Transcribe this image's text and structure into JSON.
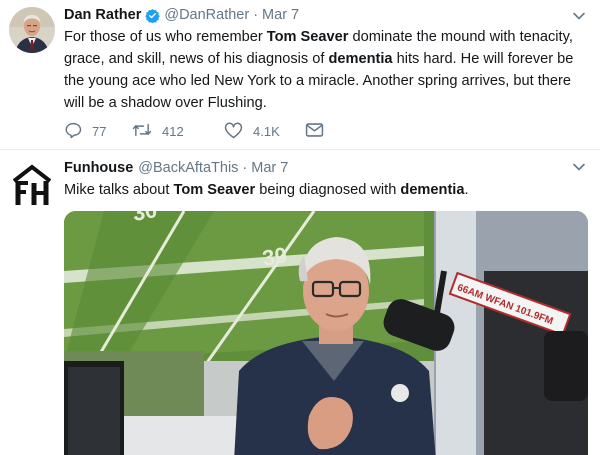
{
  "tweets": [
    {
      "author_name": "Dan Rather",
      "author_handle": "@DanRather",
      "separator": "·",
      "date": "Mar 7",
      "verified": true,
      "text_segments": [
        {
          "t": "For those of us who remember ",
          "b": false
        },
        {
          "t": "Tom Seaver",
          "b": true
        },
        {
          "t": " dominate the mound with tenacity, grace, and skill, news of his diagnosis of ",
          "b": false
        },
        {
          "t": "dementia",
          "b": true
        },
        {
          "t": " hits hard. He will forever be the young ace who led New York to a miracle. Another spring arrives, but there will be a shadow over Flushing.",
          "b": false
        }
      ],
      "actions": {
        "replies": "77",
        "retweets": "412",
        "likes": "4.1K"
      }
    },
    {
      "author_name": "Funhouse",
      "author_handle": "@BackAftaThis",
      "separator": "·",
      "date": "Mar 7",
      "verified": false,
      "text_segments": [
        {
          "t": "Mike talks about ",
          "b": false
        },
        {
          "t": "Tom Seaver",
          "b": true
        },
        {
          "t": " being diagnosed with ",
          "b": false
        },
        {
          "t": "dementia",
          "b": true
        },
        {
          "t": ".",
          "b": false
        }
      ],
      "media": {
        "microphone_flag_text": "66AM WFAN 101.9FM"
      }
    }
  ],
  "icons": {
    "verified": "verified-badge-icon",
    "caret": "chevron-down-icon",
    "reply": "reply-icon",
    "retweet": "retweet-icon",
    "like": "heart-icon",
    "dm": "direct-message-icon"
  },
  "colors": {
    "text": "#14171a",
    "secondary": "#657786",
    "verified_blue": "#1da1f2",
    "divider": "#e6ecf0"
  }
}
